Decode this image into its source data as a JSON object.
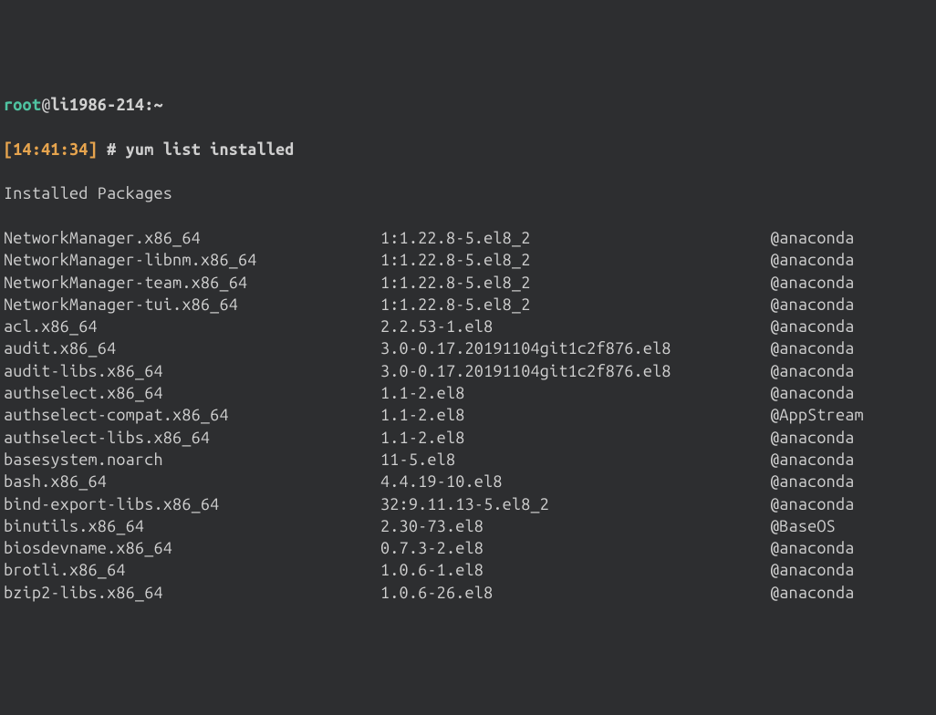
{
  "prompt": {
    "user": "root",
    "at": "@",
    "host": "li1986-214",
    "colon": ":",
    "path": "~",
    "timestamp_open": "[",
    "timestamp": "14:41:34",
    "timestamp_close": "]",
    "hash": " # ",
    "command": "yum list installed"
  },
  "header": "Installed Packages",
  "packages": [
    {
      "name": "NetworkManager.x86_64",
      "version": "1:1.22.8-5.el8_2",
      "repo": "@anaconda"
    },
    {
      "name": "NetworkManager-libnm.x86_64",
      "version": "1:1.22.8-5.el8_2",
      "repo": "@anaconda"
    },
    {
      "name": "NetworkManager-team.x86_64",
      "version": "1:1.22.8-5.el8_2",
      "repo": "@anaconda"
    },
    {
      "name": "NetworkManager-tui.x86_64",
      "version": "1:1.22.8-5.el8_2",
      "repo": "@anaconda"
    },
    {
      "name": "acl.x86_64",
      "version": "2.2.53-1.el8",
      "repo": "@anaconda"
    },
    {
      "name": "audit.x86_64",
      "version": "3.0-0.17.20191104git1c2f876.el8",
      "repo": "@anaconda"
    },
    {
      "name": "audit-libs.x86_64",
      "version": "3.0-0.17.20191104git1c2f876.el8",
      "repo": "@anaconda"
    },
    {
      "name": "authselect.x86_64",
      "version": "1.1-2.el8",
      "repo": "@anaconda"
    },
    {
      "name": "authselect-compat.x86_64",
      "version": "1.1-2.el8",
      "repo": "@AppStream"
    },
    {
      "name": "authselect-libs.x86_64",
      "version": "1.1-2.el8",
      "repo": "@anaconda"
    },
    {
      "name": "basesystem.noarch",
      "version": "11-5.el8",
      "repo": "@anaconda"
    },
    {
      "name": "bash.x86_64",
      "version": "4.4.19-10.el8",
      "repo": "@anaconda"
    },
    {
      "name": "bind-export-libs.x86_64",
      "version": "32:9.11.13-5.el8_2",
      "repo": "@anaconda"
    },
    {
      "name": "binutils.x86_64",
      "version": "2.30-73.el8",
      "repo": "@BaseOS"
    },
    {
      "name": "biosdevname.x86_64",
      "version": "0.7.3-2.el8",
      "repo": "@anaconda"
    },
    {
      "name": "brotli.x86_64",
      "version": "1.0.6-1.el8",
      "repo": "@anaconda"
    },
    {
      "name": "bzip2-libs.x86_64",
      "version": "1.0.6-26.el8",
      "repo": "@anaconda"
    }
  ]
}
